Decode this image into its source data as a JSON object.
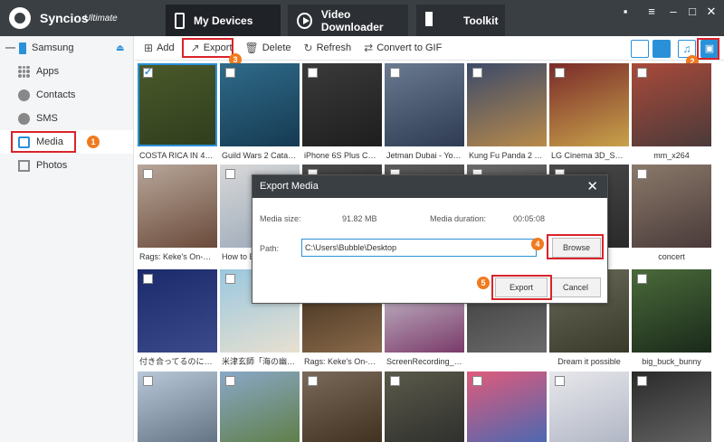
{
  "app": {
    "name": "Syncios",
    "edition": "Ultimate"
  },
  "nav": {
    "devices": "My Devices",
    "video": "Video Downloader",
    "toolkit": "Toolkit"
  },
  "device": {
    "name": "Samsung"
  },
  "sidebar": {
    "items": [
      {
        "label": "Apps",
        "icon": "apps-icon"
      },
      {
        "label": "Contacts",
        "icon": "contacts-icon"
      },
      {
        "label": "SMS",
        "icon": "sms-icon"
      },
      {
        "label": "Media",
        "icon": "media-icon"
      },
      {
        "label": "Photos",
        "icon": "photos-icon"
      }
    ]
  },
  "toolbar": {
    "add": "Add",
    "export": "Export",
    "delete": "Delete",
    "refresh": "Refresh",
    "convert": "Convert to GIF"
  },
  "badges": [
    "1",
    "2",
    "3",
    "4",
    "5"
  ],
  "tiles": [
    {
      "cap": "COSTA RICA IN 4K 60...",
      "checked": true
    },
    {
      "cap": "Guild Wars 2 Cataco..."
    },
    {
      "cap": "iPhone 6S Plus Came..."
    },
    {
      "cap": "Jetman Dubai  - You..."
    },
    {
      "cap": "Kung Fu Panda 2 Trai..."
    },
    {
      "cap": "LG Cinema 3D_Sum..."
    },
    {
      "cap": "mm_x264"
    },
    {
      "cap": "Rags: Keke's On-Set ..."
    },
    {
      "cap": "How to E..."
    },
    {
      "cap": ""
    },
    {
      "cap": ""
    },
    {
      "cap": ""
    },
    {
      "cap": ""
    },
    {
      "cap": "concert"
    },
    {
      "cap": "付き合ってるのに片思い"
    },
    {
      "cap": "米津玄師「海の幽霊」"
    },
    {
      "cap": "Rags: Keke's On-Set ..."
    },
    {
      "cap": "ScreenRecording_01-..."
    },
    {
      "cap": ""
    },
    {
      "cap": "Dream it possible"
    },
    {
      "cap": "big_buck_bunny"
    },
    {
      "cap": ""
    },
    {
      "cap": ""
    },
    {
      "cap": ""
    },
    {
      "cap": ""
    },
    {
      "cap": ""
    },
    {
      "cap": ""
    },
    {
      "cap": ""
    }
  ],
  "dialog": {
    "title": "Export Media",
    "size_label": "Media size:",
    "size_value": "91.82 MB",
    "duration_label": "Media duration:",
    "duration_value": "00:05:08",
    "path_label": "Path:",
    "path_value": "C:\\Users\\Bubble\\Desktop",
    "browse": "Browse",
    "export": "Export",
    "cancel": "Cancel"
  }
}
